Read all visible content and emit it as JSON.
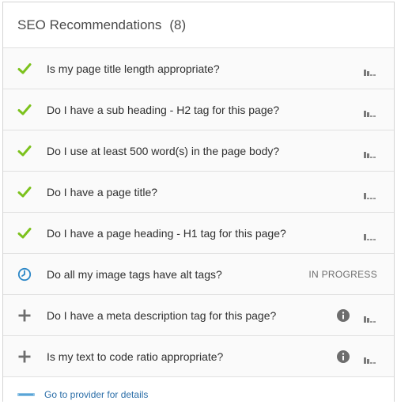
{
  "header": {
    "title": "SEO Recommendations",
    "count": "(8)"
  },
  "colors": {
    "check": "#7cc21d",
    "clock": "#2c87c7",
    "plus": "#6d6d6d",
    "info": "#6d6d6d",
    "bars": "#7a7a7a",
    "link": "#2b6ea8"
  },
  "recommendations": [
    {
      "status": "check-icon",
      "label": "Is my page title length appropriate?",
      "impact_bars": 2,
      "info": false,
      "status_text": ""
    },
    {
      "status": "check-icon",
      "label": "Do I have a sub heading - H2 tag for this page?",
      "impact_bars": 2,
      "info": false,
      "status_text": ""
    },
    {
      "status": "check-icon",
      "label": "Do I use at least 500 word(s) in the page body?",
      "impact_bars": 2,
      "info": false,
      "status_text": ""
    },
    {
      "status": "check-icon",
      "label": "Do I have a page title?",
      "impact_bars": 1,
      "info": false,
      "status_text": ""
    },
    {
      "status": "check-icon",
      "label": "Do I have a page heading - H1 tag for this page?",
      "impact_bars": 1,
      "info": false,
      "status_text": ""
    },
    {
      "status": "clock-icon",
      "label": "Do all my image tags have alt tags?",
      "impact_bars": 0,
      "info": false,
      "status_text": "IN PROGRESS"
    },
    {
      "status": "plus-icon",
      "label": "Do I have a meta description tag for this page?",
      "impact_bars": 2,
      "info": true,
      "status_text": ""
    },
    {
      "status": "plus-icon",
      "label": "Is my text to code ratio appropriate?",
      "impact_bars": 2,
      "info": true,
      "status_text": ""
    }
  ],
  "footer": {
    "link_label": "Go to provider for details"
  }
}
